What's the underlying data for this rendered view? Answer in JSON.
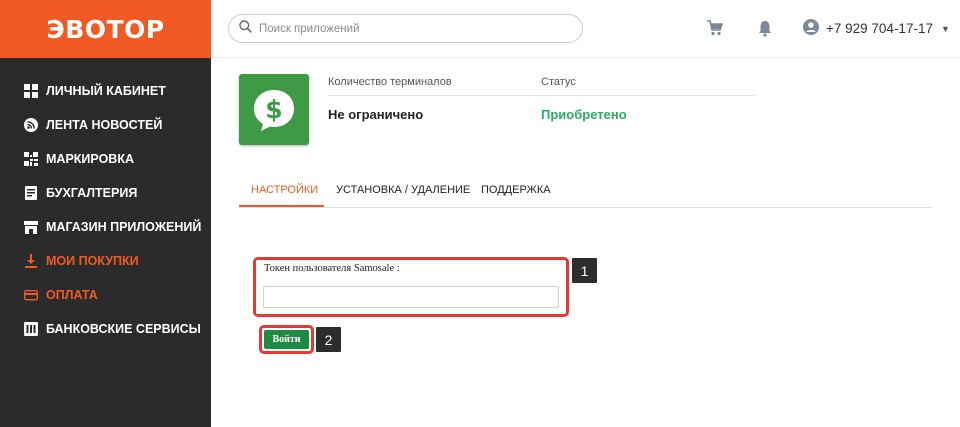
{
  "logo": {
    "text": "ЭВОТОР"
  },
  "sidebar": {
    "items": [
      {
        "label": "ЛИЧНЫЙ КАБИНЕТ",
        "icon": "grid-icon",
        "active": false
      },
      {
        "label": "ЛЕНТА НОВОСТЕЙ",
        "icon": "rss-icon",
        "active": false
      },
      {
        "label": "МАРКИРОВКА",
        "icon": "qr-code-icon",
        "active": false
      },
      {
        "label": "БУХГАЛТЕРИЯ",
        "icon": "document-icon",
        "active": false
      },
      {
        "label": "МАГАЗИН ПРИЛОЖЕНИЙ",
        "icon": "store-icon",
        "active": false
      },
      {
        "label": "МОИ ПОКУПКИ",
        "icon": "download-icon",
        "active": true
      },
      {
        "label": "ОПЛАТА",
        "icon": "card-icon",
        "active": true
      },
      {
        "label": "БАНКОВСКИЕ СЕРВИСЫ",
        "icon": "bank-icon",
        "active": false
      }
    ]
  },
  "header": {
    "search": {
      "placeholder": "Поиск приложений",
      "value": ""
    },
    "user": {
      "phone": "+7 929 704-17-17"
    }
  },
  "app": {
    "terminals_label": "Количество терминалов",
    "terminals_value": "Не ограничено",
    "status_label": "Статус",
    "status_value": "Приобретено"
  },
  "tabs": [
    {
      "label": "НАСТРОЙКИ",
      "active": true
    },
    {
      "label": "УСТАНОВКА / УДАЛЕНИЕ",
      "active": false
    },
    {
      "label": "ПОДДЕРЖКА",
      "active": false
    }
  ],
  "form": {
    "token_label": "Токен пользователя Samosale :",
    "token_value": "",
    "login_label": "Войти"
  },
  "annotations": {
    "badge1": "1",
    "badge2": "2"
  },
  "colors": {
    "brand": "#f15a24",
    "sidebar": "#2b2b2b",
    "status_green": "#27ae60",
    "highlight": "#e53935",
    "button": "#1f8a43"
  }
}
